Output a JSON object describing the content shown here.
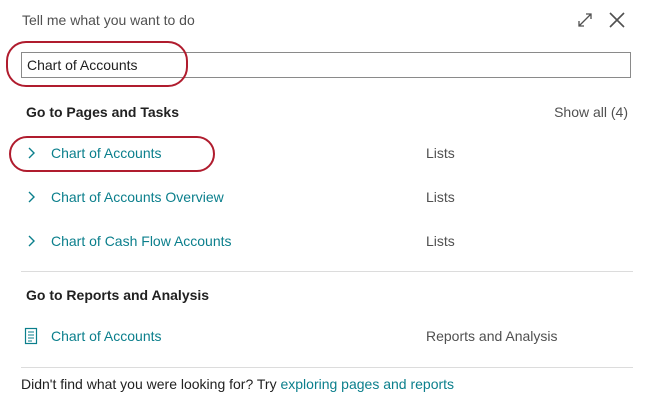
{
  "header": {
    "title": "Tell me what you want to do",
    "expand_icon": "expand-icon",
    "close_icon": "close-icon"
  },
  "search": {
    "value": "Chart of Accounts",
    "placeholder": ""
  },
  "pages_section": {
    "heading": "Go to Pages and Tasks",
    "show_all": "Show all (4)",
    "items": [
      {
        "label": "Chart of Accounts",
        "category": "Lists",
        "icon": "chevron-right-icon"
      },
      {
        "label": "Chart of Accounts Overview",
        "category": "Lists",
        "icon": "chevron-right-icon"
      },
      {
        "label": "Chart of Cash Flow Accounts",
        "category": "Lists",
        "icon": "chevron-right-icon"
      }
    ]
  },
  "reports_section": {
    "heading": "Go to Reports and Analysis",
    "items": [
      {
        "label": "Chart of Accounts",
        "category": "Reports and Analysis",
        "icon": "report-icon"
      }
    ]
  },
  "footer": {
    "text": "Didn't find what you were looking for? Try ",
    "link": "exploring pages and reports"
  },
  "colors": {
    "link": "#0b7f8c",
    "highlight": "#b01c2e",
    "divider": "#dcdcdc"
  }
}
